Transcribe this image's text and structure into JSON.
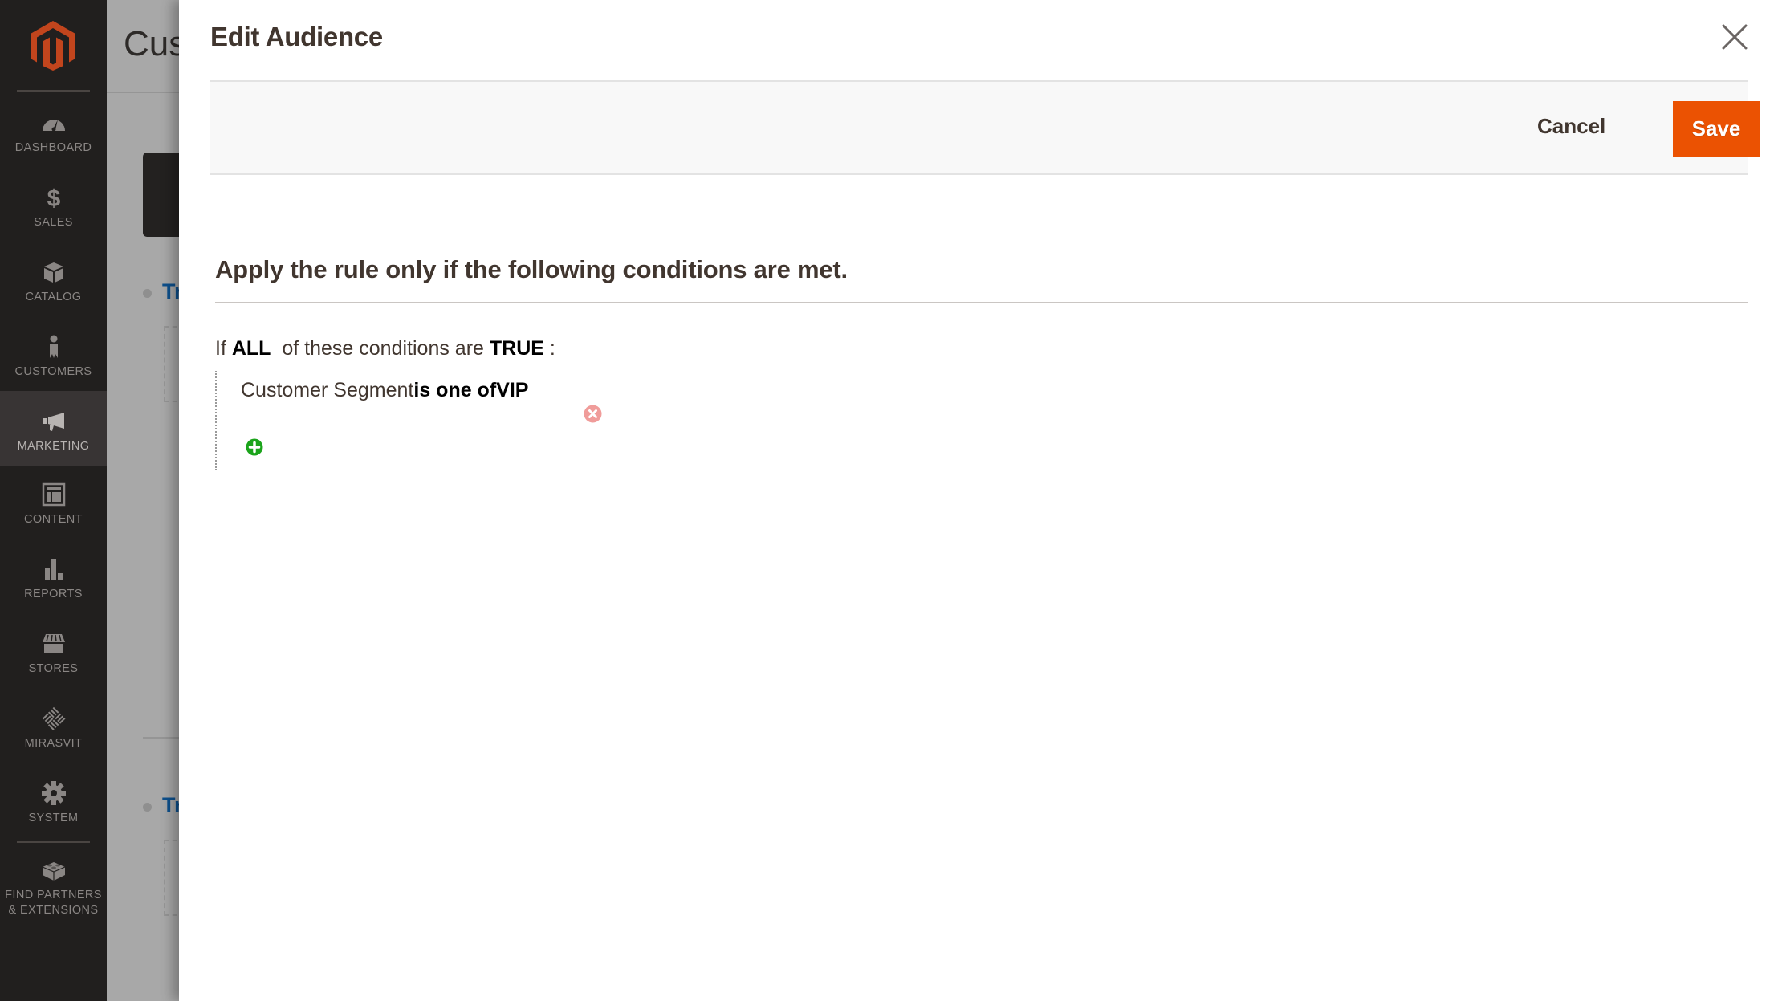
{
  "sidebar": {
    "logo": "magento-logo",
    "items": [
      {
        "label": "DASHBOARD",
        "icon": "dashboard-gauge-icon",
        "active": false
      },
      {
        "label": "SALES",
        "icon": "dollar-icon",
        "active": false
      },
      {
        "label": "CATALOG",
        "icon": "box-icon",
        "active": false
      },
      {
        "label": "CUSTOMERS",
        "icon": "person-icon",
        "active": false
      },
      {
        "label": "MARKETING",
        "icon": "megaphone-icon",
        "active": true
      },
      {
        "label": "CONTENT",
        "icon": "layout-icon",
        "active": false
      },
      {
        "label": "REPORTS",
        "icon": "bar-chart-icon",
        "active": false
      },
      {
        "label": "STORES",
        "icon": "storefront-icon",
        "active": false
      },
      {
        "label": "MIRASVIT",
        "icon": "mirasvit-icon",
        "active": false
      },
      {
        "label": "SYSTEM",
        "icon": "gear-icon",
        "active": false
      },
      {
        "label": "FIND PARTNERS\n& EXTENSIONS",
        "icon": "lego-brick-icon",
        "active": false
      }
    ]
  },
  "background_page": {
    "title_fragment": "Cus",
    "link_fragment_1": "Tr",
    "link_fragment_2": "Tr"
  },
  "modal": {
    "title": "Edit Audience",
    "close_icon": "close-icon",
    "toolbar": {
      "cancel_label": "Cancel",
      "save_label": "Save"
    },
    "conditions": {
      "heading": "Apply the rule only if the following conditions are met.",
      "rule": {
        "prefix": "If",
        "aggregator": "ALL",
        "middle": "of these conditions are",
        "value": "TRUE",
        "suffix": ":"
      },
      "items": [
        {
          "attribute": "Customer Segment",
          "operator": "is one of",
          "value": "VIP"
        }
      ],
      "add_icon": "add-condition-icon"
    }
  },
  "colors": {
    "sidebar_bg": "#211f1e",
    "sidebar_active_bg": "#383434",
    "logo": "#c2451d",
    "primary_button": "#eb5202",
    "remove_icon": "#f09c9a",
    "add_icon": "#1ba41b",
    "link": "#0d4f8b"
  }
}
